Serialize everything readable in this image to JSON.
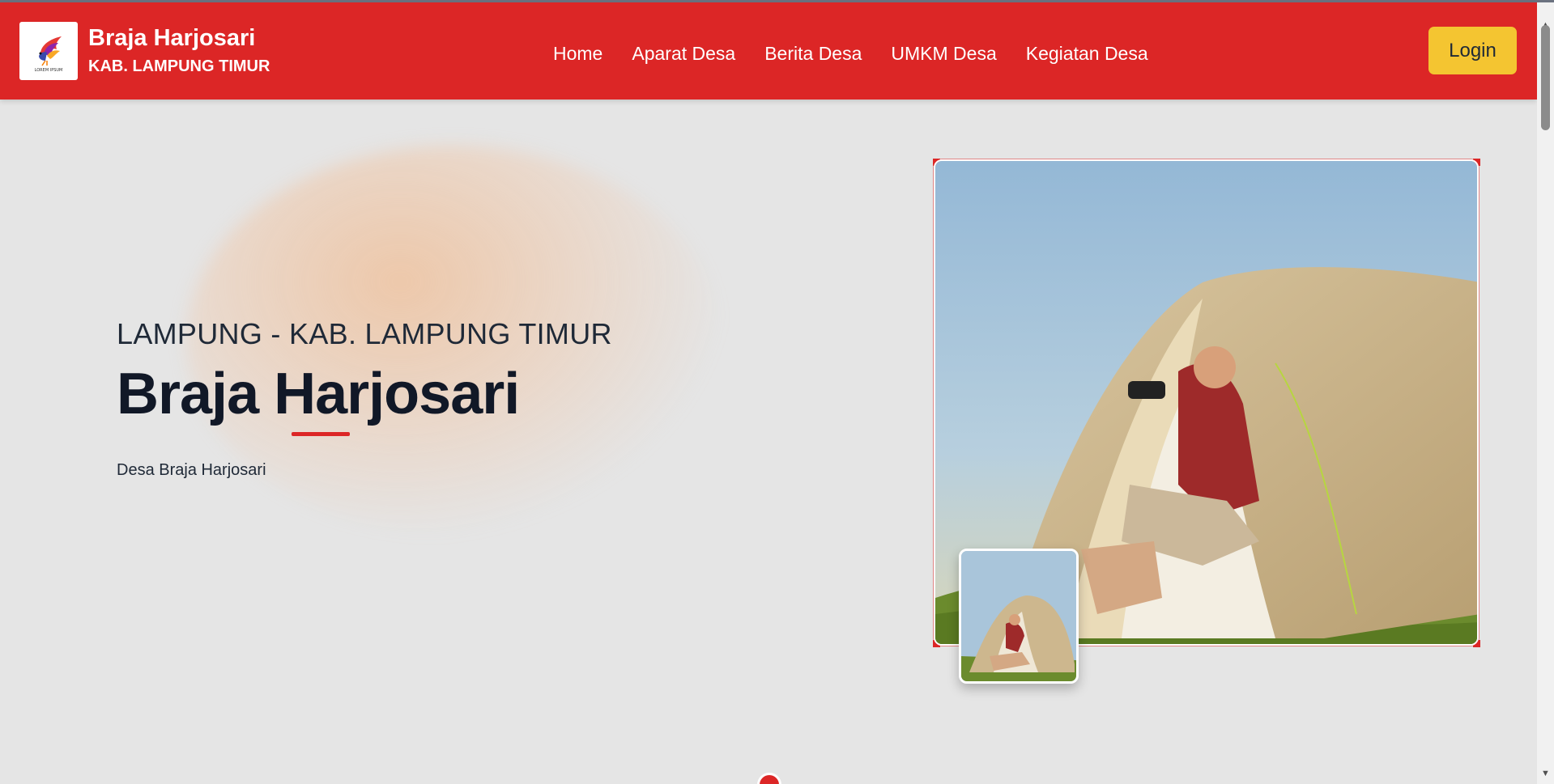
{
  "header": {
    "village_name": "Braja Harjosari",
    "regency": "KAB. LAMPUNG TIMUR",
    "logo_text": "LOREM IPSUM",
    "nav_items": [
      {
        "label": "Home"
      },
      {
        "label": "Aparat Desa"
      },
      {
        "label": "Berita Desa"
      },
      {
        "label": "UMKM Desa"
      },
      {
        "label": "Kegiatan Desa"
      }
    ],
    "login_label": "Login"
  },
  "hero": {
    "region": "LAMPUNG - KAB. LAMPUNG TIMUR",
    "title": "Braja Harjosari",
    "description": "Desa Braja Harjosari"
  },
  "colors": {
    "primary": "#dc2626",
    "accent": "#f4c531",
    "background": "#e5e5e5"
  },
  "icons": {
    "logo": "bird-logo-icon",
    "scroll_up": "arrow-up-icon",
    "scroll_down": "arrow-down-icon"
  }
}
